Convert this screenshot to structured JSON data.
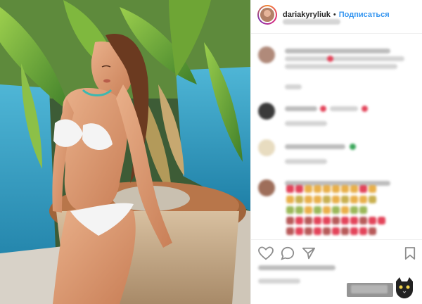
{
  "post": {
    "username": "dariakyryliuk",
    "follow_label": "Подписаться",
    "separator": "•"
  },
  "icons": {
    "like": "heart-icon",
    "comment": "comment-icon",
    "share": "share-icon",
    "save": "bookmark-icon",
    "more": "more-icon"
  },
  "colors": {
    "follow": "#3897f0",
    "username": "#262626",
    "heart": "#e3445a"
  }
}
